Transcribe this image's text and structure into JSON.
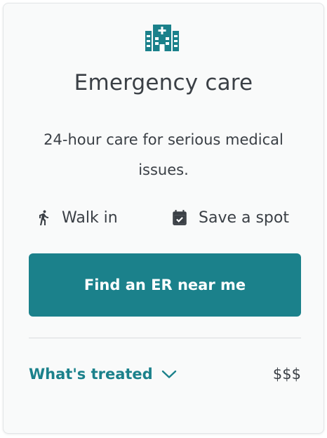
{
  "card": {
    "icon": "hospital-icon",
    "title": "Emergency care",
    "description": "24-hour care for serious medical issues.",
    "options": [
      {
        "icon": "walking-person-icon",
        "label": "Walk in"
      },
      {
        "icon": "calendar-check-icon",
        "label": "Save a spot"
      }
    ],
    "cta_label": "Find an ER near me",
    "treated_label": "What's treated",
    "treated_icon": "chevron-down-icon",
    "price": "$$$"
  },
  "colors": {
    "accent": "#1b818b",
    "text": "#3a3f45",
    "card_background": "#f9fafa",
    "divider": "#d9dcde"
  }
}
